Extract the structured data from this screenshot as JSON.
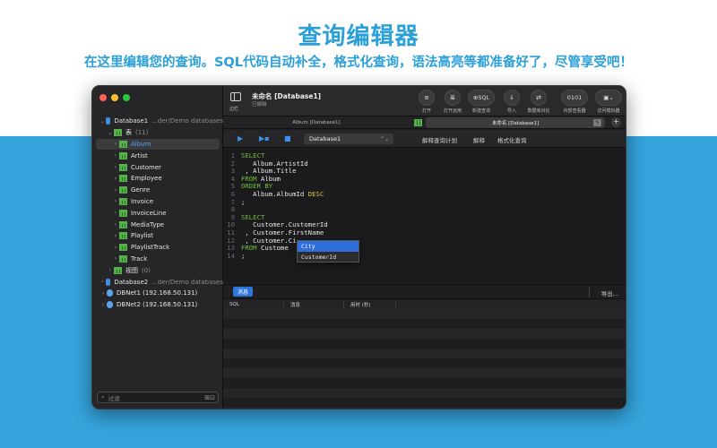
{
  "marketing": {
    "headline": "查询编辑器",
    "subline": "在这里编辑您的查询。SQL代码自动补全，格式化查询，语法高亮等都准备好了，尽管享受吧！"
  },
  "sidebar": {
    "db1": {
      "name": "Database1",
      "path": "...der/Demo databases"
    },
    "tables_label": "表",
    "tables_count": "(11)",
    "tables": [
      "Album",
      "Artist",
      "Customer",
      "Employee",
      "Genre",
      "Invoice",
      "InvoiceLine",
      "MediaType",
      "Playlist",
      "PlaylistTrack",
      "Track"
    ],
    "views_label": "视图",
    "views_count": "(0)",
    "db2": {
      "name": "Database2",
      "path": "...der/Demo databases"
    },
    "net1": "DBNet1 (192.168.50.131)",
    "net2": "DBNet2 (192.168.50.131)",
    "filter_placeholder": "过滤"
  },
  "toolbar": {
    "sidebar_label": "边栏",
    "doc_title": "未命名 [Database1]",
    "doc_sub": "已编辑",
    "buttons": {
      "open": "打开",
      "open_recent": "打开远用",
      "new_query_glyph": "⊕SQL",
      "new_query": "新建查询",
      "import": "导入",
      "compare": "数据库对比",
      "inspector_glyph": "0101",
      "inspector": "内部查看器",
      "simulator": "访问模拟器"
    }
  },
  "tabs": {
    "tab1": "Album [Database1]",
    "tab2": "未命名 [Database1]"
  },
  "querybar": {
    "database": "Database1",
    "explain_plan": "解释查询计划",
    "explain": "解释",
    "format": "格式化查询"
  },
  "editor": {
    "lines": [
      {
        "n": "1",
        "a": "SELECT",
        "b": "",
        "c": ""
      },
      {
        "n": "2",
        "a": "",
        "b": "   Album.ArtistId",
        "c": ""
      },
      {
        "n": "3",
        "a": "",
        "b": " , Album.Title",
        "c": ""
      },
      {
        "n": "4",
        "a": "FROM",
        "b": " Album",
        "c": ""
      },
      {
        "n": "5",
        "a": "ORDER BY",
        "b": "",
        "c": ""
      },
      {
        "n": "6",
        "a": "",
        "b": "   Album.AlbumId ",
        "c": "DESC"
      },
      {
        "n": "7",
        "a": "",
        "b": ";",
        "c": ""
      },
      {
        "n": "8",
        "a": "",
        "b": "",
        "c": ""
      },
      {
        "n": "9",
        "a": "SELECT",
        "b": "",
        "c": ""
      },
      {
        "n": "10",
        "a": "",
        "b": "   Customer.CustomerId",
        "c": ""
      },
      {
        "n": "11",
        "a": "",
        "b": " , Customer.FirstName",
        "c": ""
      },
      {
        "n": "12",
        "a": "",
        "b": " , Customer.Ci",
        "c": ""
      },
      {
        "n": "13",
        "a": "FROM",
        "b": " Custome",
        "c": ""
      },
      {
        "n": "14",
        "a": "",
        "b": ";",
        "c": ""
      }
    ],
    "autocomplete": [
      "City",
      "CustomerId"
    ]
  },
  "results": {
    "tab": "消息",
    "export": "导出...",
    "columns": [
      "SQL",
      "消息",
      "用时 (秒)"
    ]
  },
  "colors": {
    "brand_blue": "#2a9fd8",
    "band": "#35a4dc",
    "keyword": "#6fbf3a",
    "selection": "#2f6fdc"
  }
}
